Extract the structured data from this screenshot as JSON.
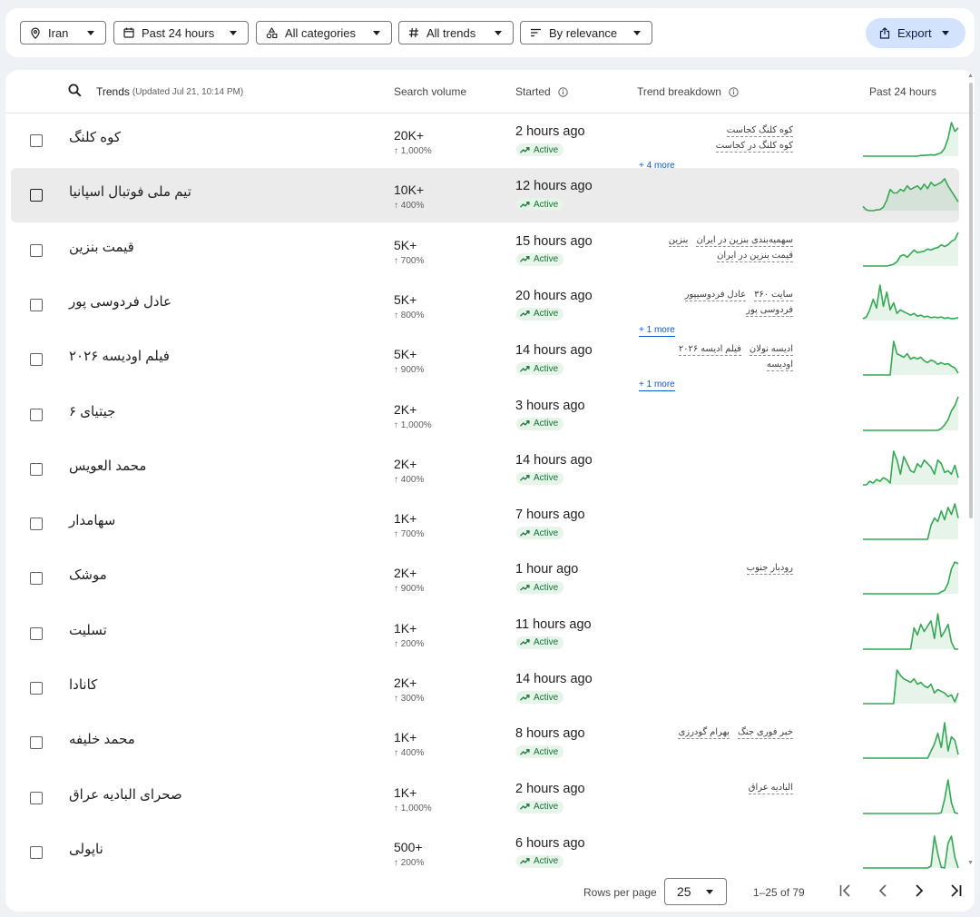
{
  "filters": {
    "geo": "Iran",
    "time": "Past 24 hours",
    "category": "All categories",
    "trend_type": "All trends",
    "sort": "By relevance",
    "export": "Export"
  },
  "table": {
    "headers": {
      "trends": "Trends",
      "updated": "(Updated Jul 21, 10:14 PM)",
      "volume": "Search volume",
      "started": "Started",
      "breakdown": "Trend breakdown",
      "past": "Past 24 hours"
    },
    "rows": [
      {
        "term": "کوه کلنگ",
        "volume": "20K+",
        "pct": "↑ 1,000%",
        "started": "2 hours ago",
        "status": "Active",
        "tags": [
          "کوه کلنگ کجاست",
          "کوه کلنگ در کجاست"
        ],
        "more": "+ 4 more",
        "spark": [
          0,
          0,
          0,
          0,
          0,
          0,
          0,
          0,
          0,
          0,
          0,
          0,
          0,
          0,
          0,
          0,
          0,
          0.02,
          0.02,
          0.03,
          0.04,
          0.03,
          0.06,
          0.1,
          0.22,
          0.5,
          0.95,
          0.7,
          0.8
        ]
      },
      {
        "term": "تیم ملی فوتبال اسپانیا",
        "volume": "10K+",
        "pct": "↑ 400%",
        "started": "12 hours ago",
        "status": "Active",
        "tags": [],
        "more": "",
        "spark": [
          0.12,
          0.02,
          0,
          0,
          0.02,
          0.03,
          0.1,
          0.3,
          0.6,
          0.5,
          0.5,
          0.6,
          0.55,
          0.7,
          0.6,
          0.65,
          0.7,
          0.6,
          0.75,
          0.62,
          0.8,
          0.7,
          0.75,
          0.8,
          0.9,
          0.7,
          0.55,
          0.4,
          0.25
        ]
      },
      {
        "term": "قیمت بنزین",
        "volume": "5K+",
        "pct": "↑ 700%",
        "started": "15 hours ago",
        "status": "Active",
        "tags": [
          "سهمیه‌بندی بنزین در ایران",
          "بنزین",
          "قیمت بنزین در ایران"
        ],
        "more": "",
        "spark": [
          0,
          0,
          0,
          0,
          0,
          0,
          0,
          0,
          0.02,
          0.05,
          0.12,
          0.28,
          0.32,
          0.25,
          0.35,
          0.45,
          0.38,
          0.4,
          0.42,
          0.48,
          0.45,
          0.5,
          0.52,
          0.6,
          0.55,
          0.6,
          0.7,
          0.75,
          0.95
        ]
      },
      {
        "term": "عادل فردوسی پور",
        "volume": "5K+",
        "pct": "↑ 800%",
        "started": "20 hours ago",
        "status": "Active",
        "tags": [
          "سایت ۳۶۰",
          "عادل فردوسیپور",
          "فردوسی پور"
        ],
        "more": "+ 1 more",
        "spark": [
          0.05,
          0.1,
          0.3,
          0.6,
          0.35,
          1.0,
          0.4,
          0.8,
          0.3,
          0.5,
          0.2,
          0.3,
          0.25,
          0.2,
          0.15,
          0.2,
          0.12,
          0.15,
          0.1,
          0.12,
          0.08,
          0.1,
          0.08,
          0.1,
          0.06,
          0.08,
          0.05,
          0.06,
          0.08
        ]
      },
      {
        "term": "فیلم اودیسه ۲۰۲۶",
        "volume": "5K+",
        "pct": "↑ 900%",
        "started": "14 hours ago",
        "status": "Active",
        "tags": [
          "ادیسه نولان",
          "فیلم ادیسه ۲۰۲۶",
          "اودیسه"
        ],
        "more": "+ 1 more",
        "spark": [
          0,
          0,
          0,
          0,
          0,
          0,
          0,
          0,
          0,
          0.95,
          0.6,
          0.55,
          0.5,
          0.6,
          0.45,
          0.5,
          0.45,
          0.5,
          0.4,
          0.35,
          0.42,
          0.38,
          0.3,
          0.35,
          0.3,
          0.32,
          0.25,
          0.2,
          0.05
        ]
      },
      {
        "term": "جیتیای ۶",
        "volume": "2K+",
        "pct": "↑ 1,000%",
        "started": "3 hours ago",
        "status": "Active",
        "tags": [],
        "more": "",
        "spark": [
          0,
          0,
          0,
          0,
          0,
          0,
          0,
          0,
          0,
          0,
          0,
          0,
          0,
          0,
          0,
          0,
          0,
          0,
          0,
          0,
          0,
          0,
          0,
          0.05,
          0.15,
          0.3,
          0.55,
          0.7,
          0.95
        ]
      },
      {
        "term": "محمد العویس",
        "volume": "2K+",
        "pct": "↑ 400%",
        "started": "14 hours ago",
        "status": "Active",
        "tags": [],
        "more": "",
        "spark": [
          0,
          0,
          0.1,
          0.05,
          0.15,
          0.1,
          0.2,
          0.15,
          0.05,
          0.95,
          0.7,
          0.3,
          0.8,
          0.6,
          0.4,
          0.35,
          0.6,
          0.5,
          0.7,
          0.6,
          0.5,
          0.3,
          0.7,
          0.6,
          0.35,
          0.4,
          0.3,
          0.55,
          0.2
        ]
      },
      {
        "term": "سهامدار",
        "volume": "1K+",
        "pct": "↑ 700%",
        "started": "7 hours ago",
        "status": "Active",
        "tags": [],
        "more": "",
        "spark": [
          0,
          0,
          0,
          0,
          0,
          0,
          0,
          0,
          0,
          0,
          0,
          0,
          0,
          0,
          0,
          0,
          0,
          0,
          0,
          0,
          0.4,
          0.6,
          0.5,
          0.8,
          0.55,
          0.9,
          0.7,
          1.0,
          0.6
        ]
      },
      {
        "term": "موشک",
        "volume": "2K+",
        "pct": "↑ 900%",
        "started": "1 hour ago",
        "status": "Active",
        "tags": [
          "رودبار جنوب"
        ],
        "more": "",
        "spark": [
          0,
          0,
          0,
          0,
          0,
          0,
          0,
          0,
          0,
          0,
          0,
          0,
          0,
          0,
          0,
          0,
          0,
          0,
          0,
          0,
          0,
          0,
          0,
          0.05,
          0.1,
          0.3,
          0.7,
          0.9,
          0.85
        ]
      },
      {
        "term": "تسلیت",
        "volume": "1K+",
        "pct": "↑ 200%",
        "started": "11 hours ago",
        "status": "Active",
        "tags": [],
        "more": "",
        "spark": [
          0,
          0,
          0,
          0,
          0,
          0,
          0,
          0,
          0,
          0,
          0,
          0,
          0,
          0,
          0,
          0.6,
          0.4,
          0.7,
          0.5,
          0.65,
          0.8,
          0.3,
          1.0,
          0.35,
          0.5,
          0.7,
          0.2,
          0,
          0
        ]
      },
      {
        "term": "کانادا",
        "volume": "2K+",
        "pct": "↑ 300%",
        "started": "14 hours ago",
        "status": "Active",
        "tags": [],
        "more": "",
        "spark": [
          0,
          0,
          0,
          0,
          0,
          0,
          0,
          0,
          0,
          0,
          0.95,
          0.8,
          0.7,
          0.65,
          0.6,
          0.7,
          0.55,
          0.6,
          0.5,
          0.45,
          0.55,
          0.3,
          0.4,
          0.35,
          0.3,
          0.2,
          0.25,
          0.05,
          0.3
        ]
      },
      {
        "term": "محمد خلیفه",
        "volume": "1K+",
        "pct": "↑ 400%",
        "started": "8 hours ago",
        "status": "Active",
        "tags": [
          "خبر فوری جنگ",
          "بهرام گودرزی"
        ],
        "more": "",
        "spark": [
          0,
          0,
          0,
          0,
          0,
          0,
          0,
          0,
          0,
          0,
          0,
          0,
          0,
          0,
          0,
          0,
          0,
          0,
          0,
          0,
          0.2,
          0.4,
          0.7,
          0.3,
          1.0,
          0.2,
          0.6,
          0.5,
          0.1
        ]
      },
      {
        "term": "صحرای البادیه عراق",
        "volume": "1K+",
        "pct": "↑ 1,000%",
        "started": "2 hours ago",
        "status": "Active",
        "tags": [
          "البادیه عراق"
        ],
        "more": "",
        "spark": [
          0,
          0,
          0,
          0,
          0,
          0,
          0,
          0,
          0,
          0,
          0,
          0,
          0,
          0,
          0,
          0,
          0,
          0,
          0,
          0,
          0,
          0,
          0,
          0.02,
          0.4,
          0.95,
          0.3,
          0.02,
          0
        ]
      },
      {
        "term": "ناپولی",
        "volume": "500+",
        "pct": "↑ 200%",
        "started": "6 hours ago",
        "status": "Active",
        "tags": [],
        "more": "",
        "spark": [
          0,
          0,
          0,
          0,
          0,
          0,
          0,
          0,
          0,
          0,
          0,
          0,
          0,
          0,
          0,
          0,
          0,
          0,
          0,
          0,
          0.05,
          0.9,
          0.4,
          0.02,
          0,
          0.7,
          0.9,
          0.3,
          0
        ]
      }
    ]
  },
  "pagination": {
    "rows_label": "Rows per page",
    "rows_value": "25",
    "range": "1–25 of 79"
  },
  "colors": {
    "spark_line": "#34a853",
    "accent": "#d3e3fd",
    "active_bg": "#e6f4ea",
    "active_text": "#137333"
  },
  "icons": {
    "geo": "location-pin-icon",
    "time": "calendar-icon",
    "category": "shapes-icon",
    "trend_type": "hashtag-icon",
    "sort": "sort-lines-icon",
    "export": "share-upload-icon",
    "search": "search-icon",
    "info": "info-icon",
    "active": "trending-up-icon"
  }
}
